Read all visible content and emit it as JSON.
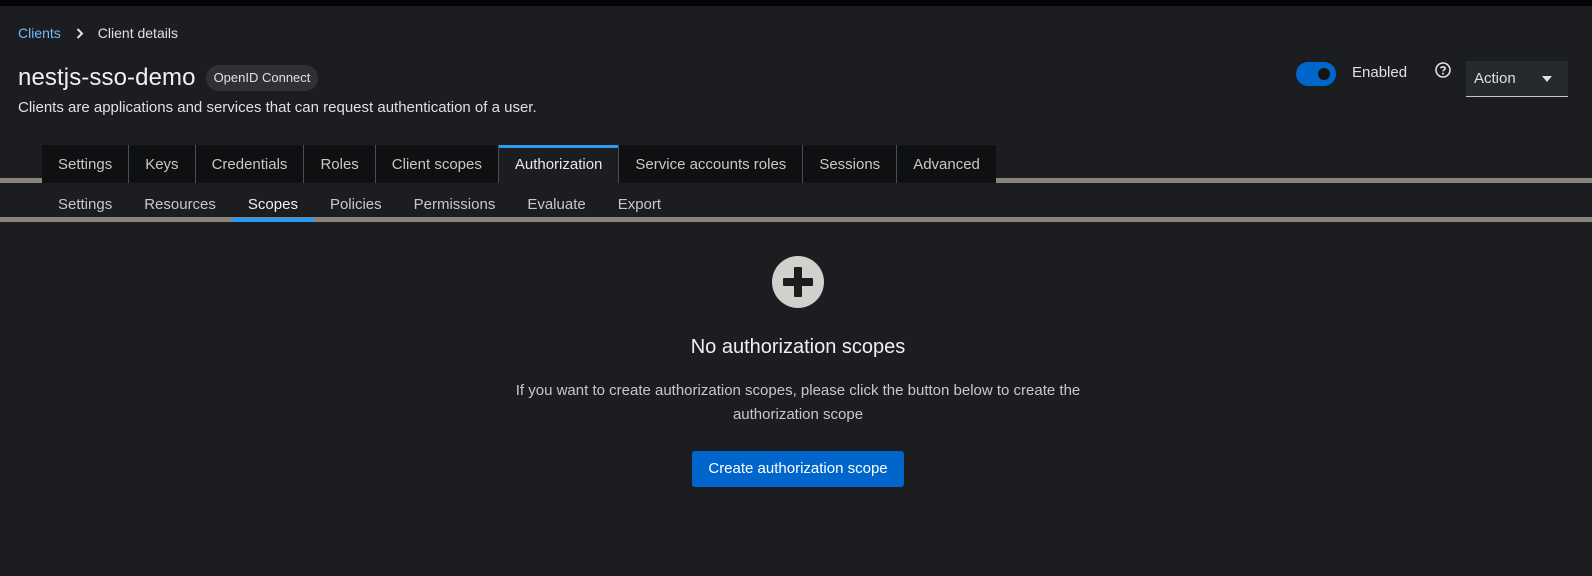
{
  "breadcrumb": {
    "parent": "Clients",
    "current": "Client details"
  },
  "header": {
    "title": "nestjs-sso-demo",
    "protocol_badge": "OpenID Connect",
    "subtitle": "Clients are applications and services that can request authentication of a user.",
    "enabled_label": "Enabled",
    "enabled": true,
    "action_label": "Action"
  },
  "main_tabs": [
    "Settings",
    "Keys",
    "Credentials",
    "Roles",
    "Client scopes",
    "Authorization",
    "Service accounts roles",
    "Sessions",
    "Advanced"
  ],
  "main_tab_active": "Authorization",
  "sub_tabs": [
    "Settings",
    "Resources",
    "Scopes",
    "Policies",
    "Permissions",
    "Evaluate",
    "Export"
  ],
  "sub_tab_active": "Scopes",
  "empty_state": {
    "icon": "plus-circle-icon",
    "title": "No authorization scopes",
    "body": "If you want to create authorization scopes, please click the button below to create the authorization scope",
    "button_label": "Create authorization scope"
  },
  "colors": {
    "accent": "#0066cc",
    "link": "#73bcf7",
    "background": "#1b1d21",
    "tab_bar": "#0f1012"
  }
}
